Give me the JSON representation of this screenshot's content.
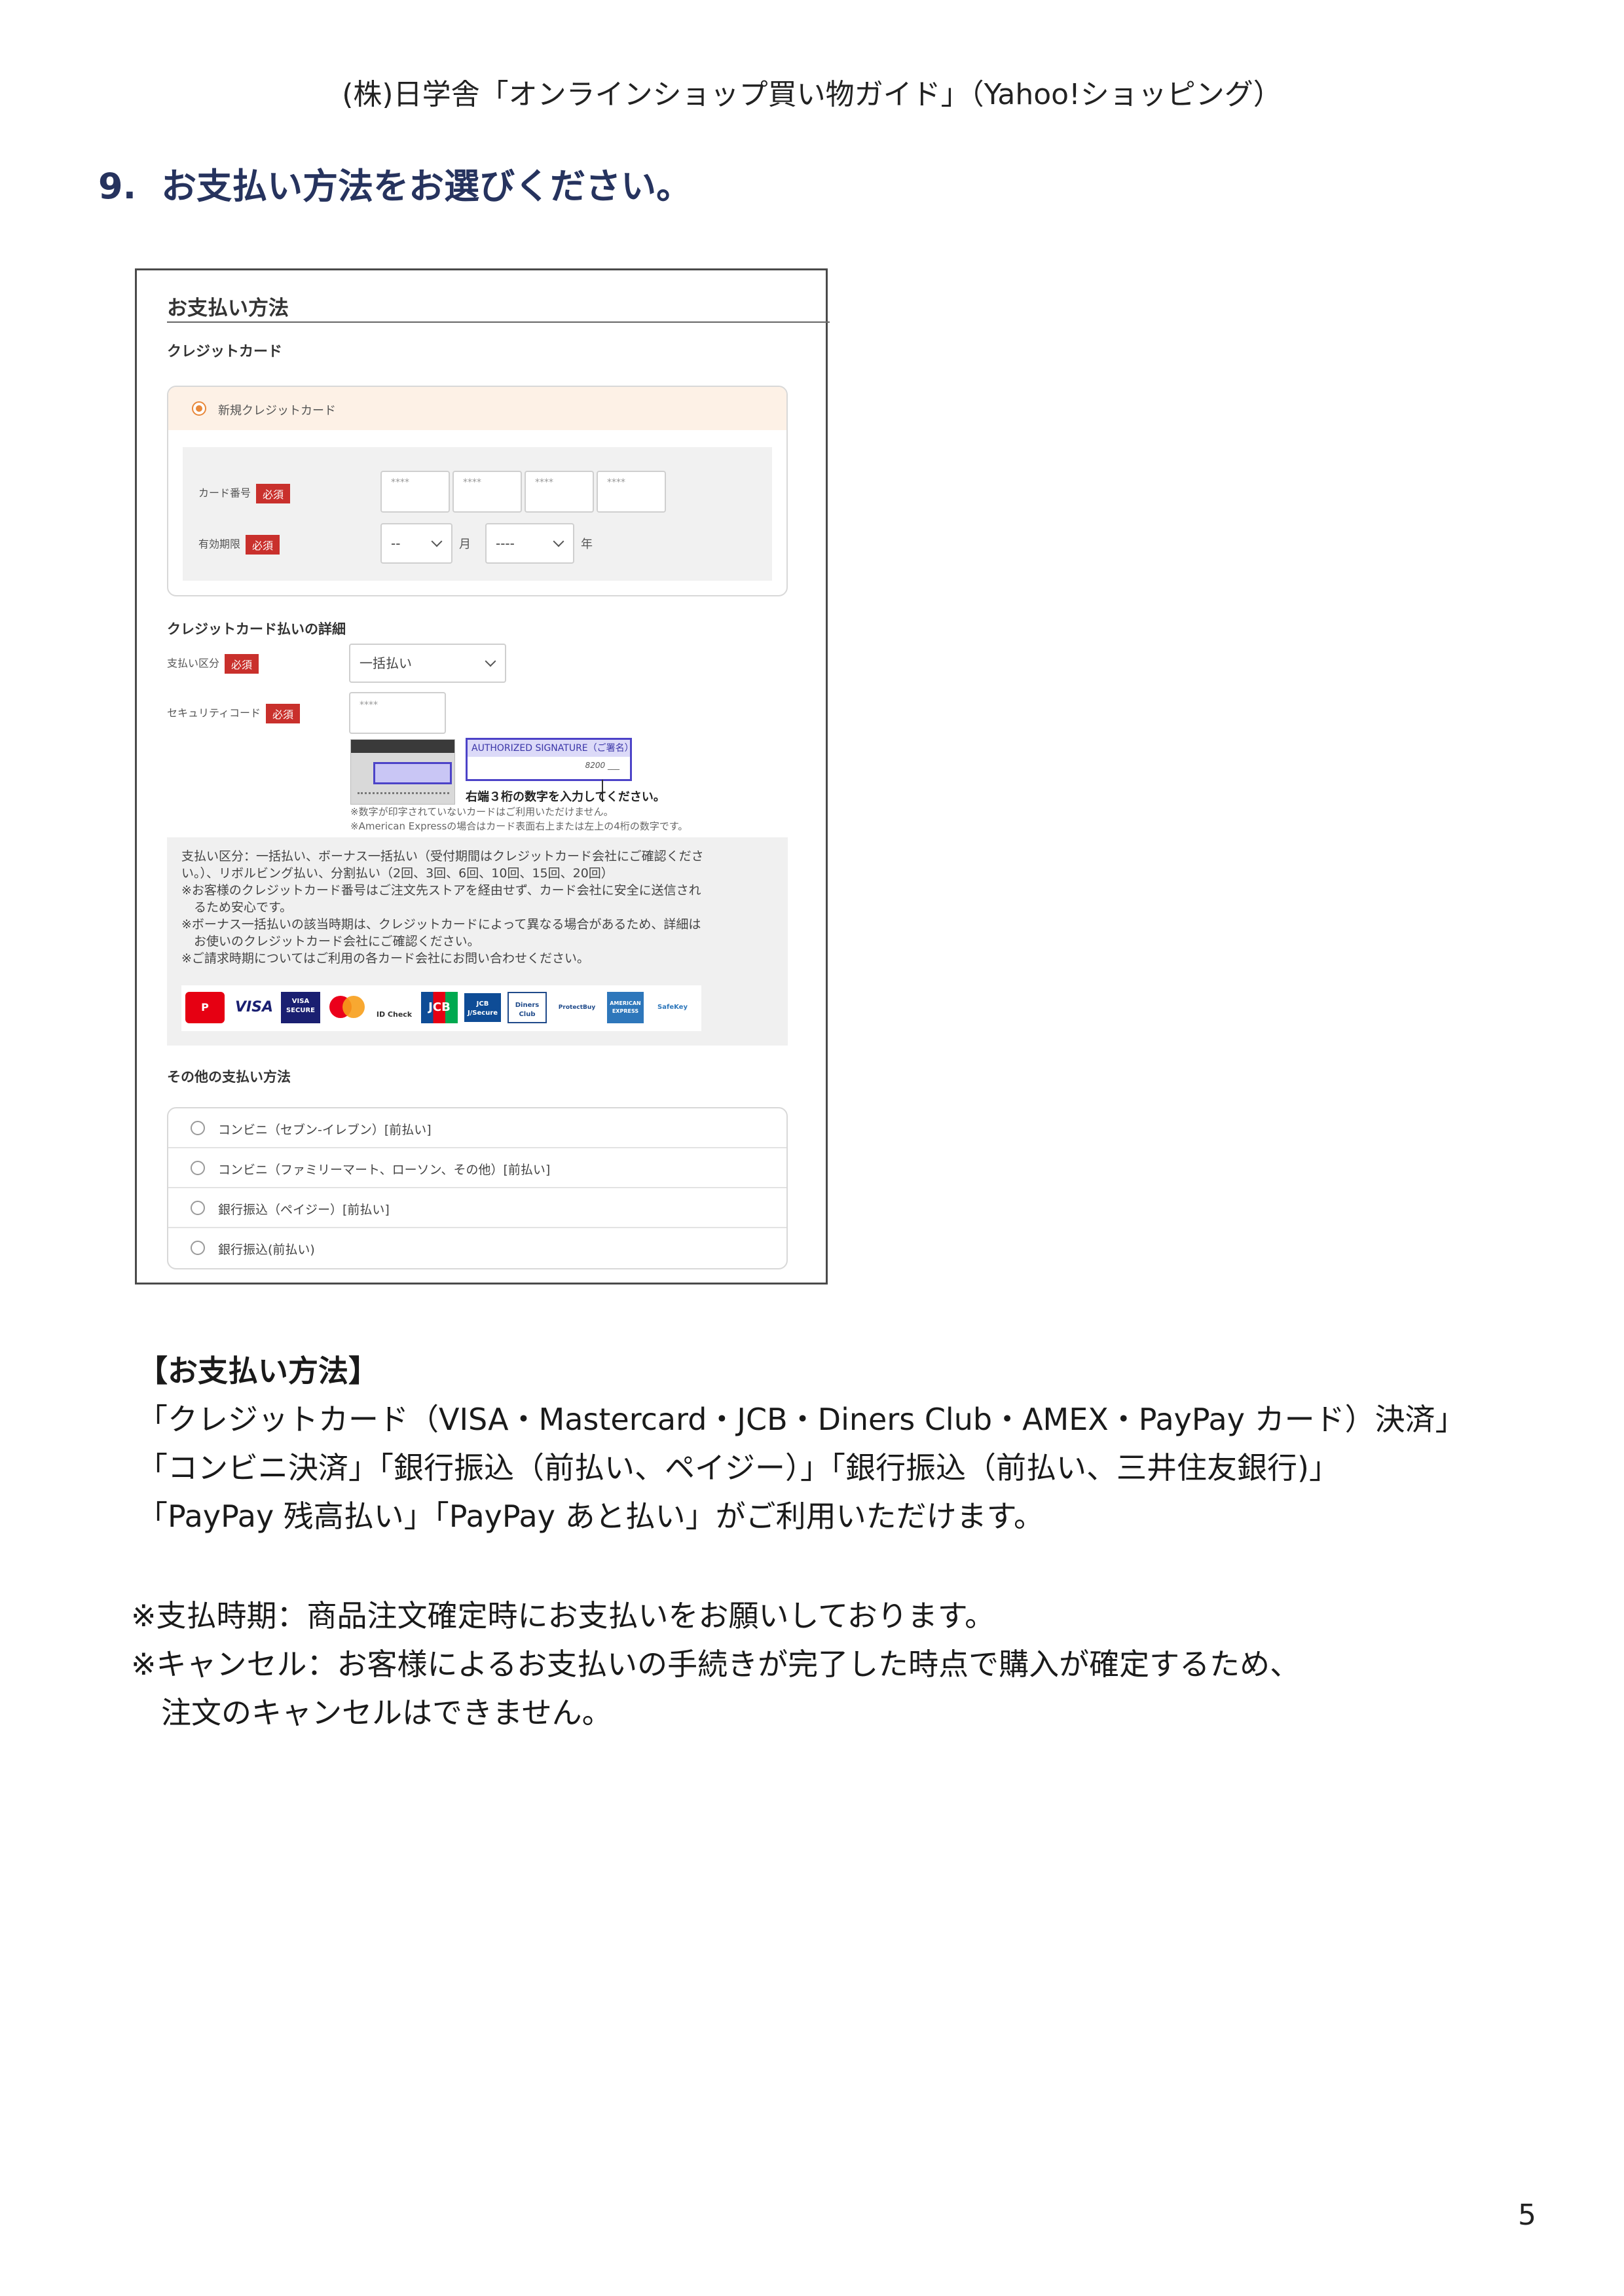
{
  "header": "(株)日学舎「オンラインショップ買い物ガイド」（Yahoo!ショッピング）",
  "section": {
    "number": "9.",
    "title": "お支払い方法をお選びください。"
  },
  "screenshot": {
    "title": "お支払い方法",
    "credit_heading": "クレジットカード",
    "new_card_label": "新規クレジットカード",
    "card_number_label": "カード番号",
    "expiry_label": "有効期限",
    "required": "必須",
    "card_placeholder": "****",
    "month_default": "--",
    "month_unit": "月",
    "year_default": "----",
    "year_unit": "年",
    "details_heading": "クレジットカード払いの詳細",
    "pay_type_label": "支払い区分",
    "pay_type_value": "一括払い",
    "security_label": "セキュリティコード",
    "security_placeholder": "****",
    "signature_title": "AUTHORIZED SIGNATURE（ご署名）",
    "signature_digits": "8200 ___",
    "cvv_instruction": "右端３桁の数字を入力してください。",
    "cvv_note1": "※数字が印字されていないカードはご利用いただけません。",
    "cvv_note2": "※American Expressの場合はカード表面右上または左上の4桁の数字です。",
    "notes": [
      "支払い区分：一括払い、ボーナス一括払い（受付期間はクレジットカード会社にご確認くださ",
      "い。）、リボルビング払い、分割払い（2回、3回、6回、10回、15回、20回）",
      "※お客様のクレジットカード番号はご注文先ストアを経由せず、カード会社に安全に送信され",
      "　るため安心です。",
      "※ボーナス一括払いの該当時期は、クレジットカードによって異なる場合があるため、詳細は",
      "　お使いのクレジットカード会社にご確認ください。",
      "※ご請求時期についてはご利用の各カード会社にお問い合わせください。"
    ],
    "logos": [
      "P",
      "VISA",
      "VISA SECURE",
      "mastercard",
      "ID Check",
      "JCB",
      "JCB J/Secure",
      "Diners Club",
      "ProtectBuy",
      "AMERICAN EXPRESS",
      "SafeKey"
    ],
    "other_heading": "その他の支払い方法",
    "other_methods": [
      "コンビニ（セブン-イレブン）[前払い]",
      "コンビニ（ファミリーマート、ローソン、その他）[前払い]",
      "銀行振込（ペイジー）[前払い]",
      "銀行振込(前払い)"
    ]
  },
  "body": {
    "heading": "【お支払い方法】",
    "line1": "「クレジットカード（VISA・Mastercard・JCB・Diners Club・AMEX・PayPay カード）決済」",
    "line2": "「コンビニ決済」「銀行振込（前払い、ペイジー）」「銀行振込（前払い、三井住友銀行)」",
    "line3": "「PayPay 残高払い」「PayPay あと払い」がご利用いただけます。",
    "note1": "※支払時期：商品注文確定時にお支払いをお願いしております。",
    "note2": "※キャンセル：お客様によるお支払いの手続きが完了した時点で購入が確定するため、",
    "note3": "注文のキャンセルはできません。"
  },
  "page_number": "5"
}
